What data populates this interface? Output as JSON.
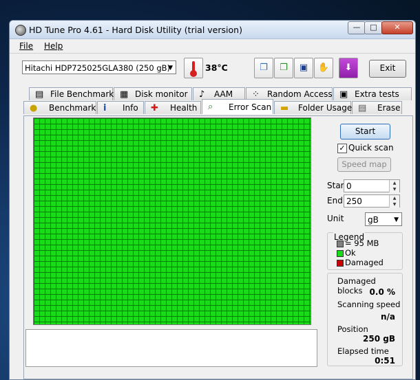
{
  "window": {
    "title": "HD Tune Pro 4.61 - Hard Disk Utility (trial version)"
  },
  "titlebar": {
    "minimize": "—",
    "maximize": "□",
    "close": "✕"
  },
  "menu": {
    "file": "File",
    "help": "Help"
  },
  "toolbar": {
    "drive": "Hitachi HDP725025GLA380 (250 gB)",
    "temperature": "38°C",
    "exit_label": "Exit",
    "icons": [
      "copy-info-icon",
      "copy-screenshot-icon",
      "save-icon",
      "options-icon",
      "download-icon"
    ]
  },
  "tabs": {
    "top": [
      {
        "label": "File Benchmark",
        "icon": "▤"
      },
      {
        "label": "Disk monitor",
        "icon": "▦"
      },
      {
        "label": "AAM",
        "icon": "♪"
      },
      {
        "label": "Random Access",
        "icon": "⁘"
      },
      {
        "label": "Extra tests",
        "icon": "▣"
      }
    ],
    "bottom": [
      {
        "label": "Benchmark",
        "icon": "●"
      },
      {
        "label": "Info",
        "icon": "i"
      },
      {
        "label": "Health",
        "icon": "✚"
      },
      {
        "label": "Error Scan",
        "icon": "⌕"
      },
      {
        "label": "Folder Usage",
        "icon": "▬"
      },
      {
        "label": "Erase",
        "icon": "▤"
      }
    ],
    "active": "Error Scan"
  },
  "error_scan": {
    "start_label": "Start",
    "quick_scan_label": "Quick scan",
    "quick_scan_checked": true,
    "speed_map_label": "Speed map",
    "start_field_label": "Start",
    "start_value": "0",
    "end_field_label": "End",
    "end_value": "250",
    "unit_label": "Unit",
    "unit_value": "gB",
    "legend": {
      "title": "Legend",
      "block": "= 95 MB",
      "ok": "Ok",
      "damaged": "Damaged",
      "colors": {
        "block": "#808080",
        "ok": "#19dc19",
        "damaged": "#c80000"
      }
    },
    "stats": {
      "damaged_blocks_label": "Damaged blocks",
      "damaged_blocks_value": "0.0 %",
      "scanning_speed_label": "Scanning speed",
      "scanning_speed_value": "n/a",
      "position_label": "Position",
      "position_value": "250 gB",
      "elapsed_label": "Elapsed time",
      "elapsed_value": "0:51"
    },
    "grid_color": "#19dc19"
  }
}
